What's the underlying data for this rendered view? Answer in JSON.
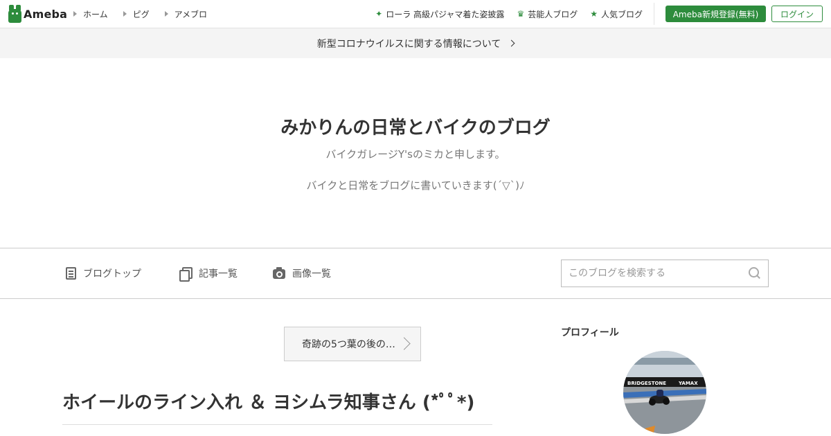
{
  "header": {
    "logo_text": "Ameba",
    "nav": [
      {
        "label": "ホーム"
      },
      {
        "label": "ピグ"
      },
      {
        "label": "アメブロ"
      }
    ],
    "right_nav": [
      {
        "label": "ローラ 高級パジャマ着た姿披露",
        "icon": "sparkle-icon"
      },
      {
        "label": "芸能人ブログ",
        "icon": "crown-icon"
      },
      {
        "label": "人気ブログ",
        "icon": "star-icon"
      }
    ],
    "register_label": "Ameba新規登録(無料)",
    "login_label": "ログイン"
  },
  "notice": {
    "text": "新型コロナウイルスに関する情報について"
  },
  "blog": {
    "title": "みかりんの日常とバイクのブログ",
    "subtitle": "バイクガレージY'sのミカと申します。",
    "description": "バイクと日常をブログに書いていきます(´▽`)ﾉ"
  },
  "blog_nav": {
    "items": [
      {
        "label": "ブログトップ",
        "icon": "document-icon"
      },
      {
        "label": "記事一覧",
        "icon": "copy-icon"
      },
      {
        "label": "画像一覧",
        "icon": "camera-icon"
      }
    ],
    "search_placeholder": "このブログを検索する"
  },
  "entry": {
    "prev_label": "奇跡の5つ葉の後の…",
    "title": "ホイールのライン入れ ＆ ヨシムラ知事さん (*ﾟﾟ*)"
  },
  "sidebar": {
    "profile_heading": "プロフィール",
    "avatar_banner": "BRIDGESTONE",
    "avatar_banner2": "YAMAX"
  },
  "colors": {
    "brand": "#2d8c3c"
  }
}
